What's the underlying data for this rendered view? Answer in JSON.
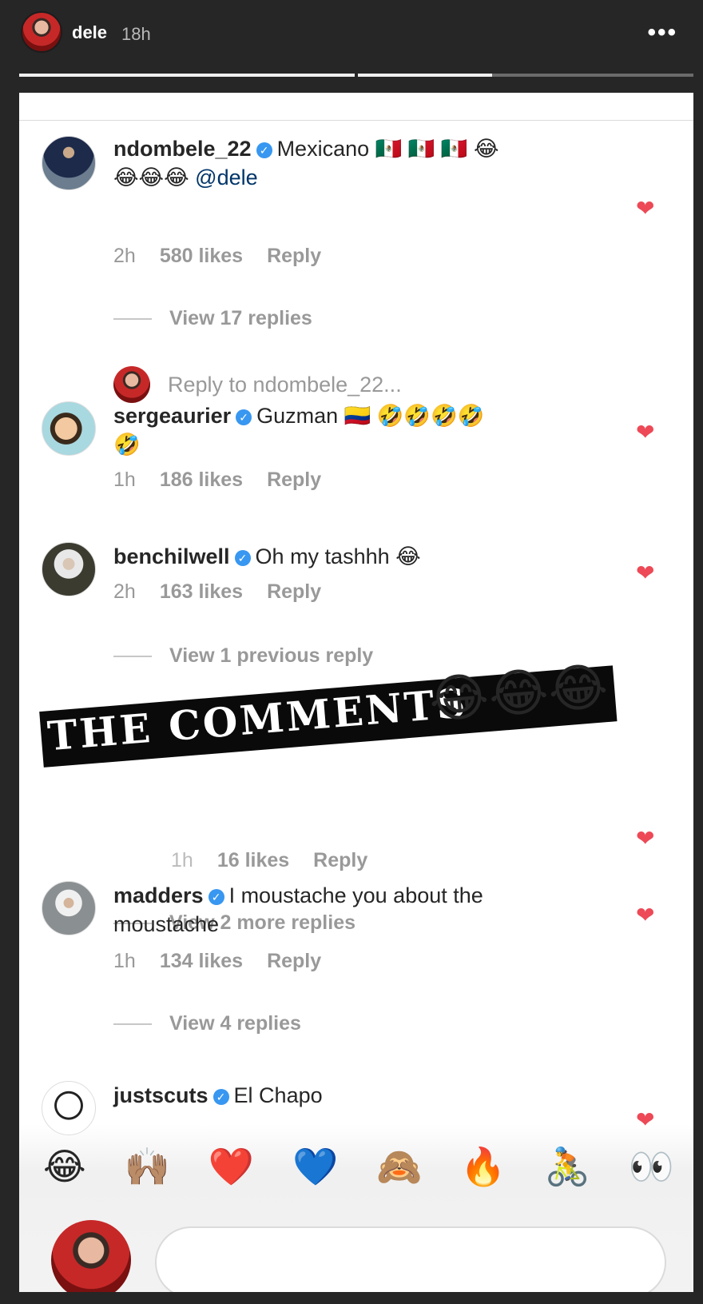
{
  "story": {
    "username": "dele",
    "time": "18h",
    "more": "•••",
    "progress": [
      1.0,
      0.4
    ]
  },
  "comments": [
    {
      "username": "ndombele_22",
      "text": "Mexicano",
      "text2": "@dele",
      "emojis_a": "🇲🇽 🇲🇽 🇲🇽  😂",
      "emojis_b": "😂😂😂",
      "time": "2h",
      "likes": "580 likes",
      "reply": "Reply",
      "view_replies": "View 17 replies",
      "reply_to": "Reply to ndombele_22..."
    },
    {
      "username": "sergeaurier",
      "text": "Guzman",
      "emojis_a": "🇨🇴  🤣🤣🤣🤣",
      "emojis_b": "🤣",
      "time": "1h",
      "likes": "186 likes",
      "reply": "Reply"
    },
    {
      "username": "benchilwell",
      "text": "Oh my tashhh",
      "emojis_a": "😂",
      "time": "2h",
      "likes": "163 likes",
      "reply": "Reply",
      "view_replies": "View 1 previous reply"
    },
    {
      "partial_likes": "16 likes",
      "partial_time": "1h",
      "reply": "Reply",
      "view_replies": "View 2 more replies"
    },
    {
      "username": "madders",
      "text": "I moustache you about the moustache",
      "time": "1h",
      "likes": "134 likes",
      "reply": "Reply",
      "view_replies": "View 4 replies"
    },
    {
      "username": "justscuts",
      "text": "El Chapo"
    }
  ],
  "sticker": {
    "text": "THE COMMENTS",
    "emojis": "😂😂😂"
  },
  "emoji_bar": [
    "😂",
    "🙌🏽",
    "❤️",
    "💙",
    "🙈",
    "🔥",
    "🚴",
    "👀"
  ],
  "colors": {
    "verified": "#3897f0",
    "heart": "#ed4956",
    "meta": "#999999",
    "mention": "#003569"
  }
}
